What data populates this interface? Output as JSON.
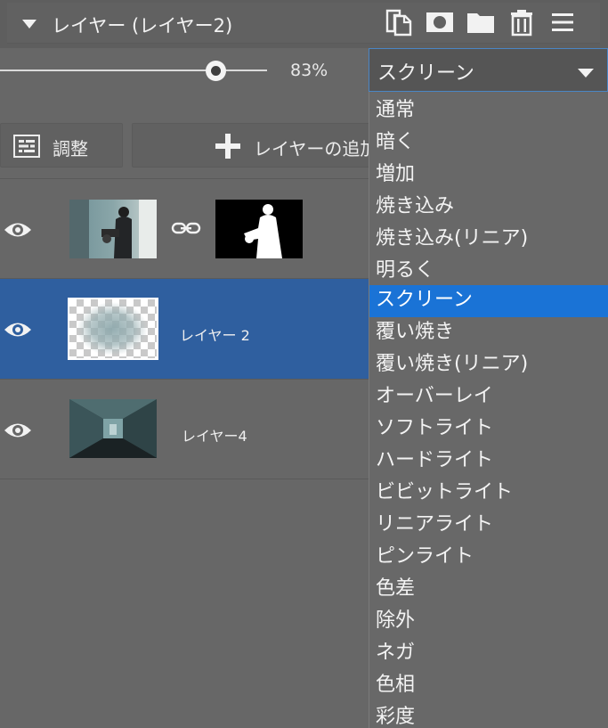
{
  "panel": {
    "title": "レイヤー (レイヤー2)",
    "icons": [
      "duplicate-layer-icon",
      "add-mask-icon",
      "folder-icon",
      "delete-icon",
      "menu-icon"
    ]
  },
  "opacity": {
    "value": 83,
    "label": "83%"
  },
  "blend_mode": {
    "selected": "スクリーン",
    "options": [
      "通常",
      "暗く",
      "増加",
      "焼き込み",
      "焼き込み(リニア)",
      "明るく",
      "スクリーン",
      "覆い焼き",
      "覆い焼き(リニア)",
      "オーバーレイ",
      "ソフトライト",
      "ハードライト",
      "ビビットライト",
      "リニアライト",
      "ピンライト",
      "色差",
      "除外",
      "ネガ",
      "色相",
      "彩度"
    ]
  },
  "buttons": {
    "adjust": "調整",
    "add_layer": "レイヤーの追加"
  },
  "layers": [
    {
      "name": "",
      "visible": true,
      "linked_mask": true,
      "selected": false
    },
    {
      "name": "レイヤー 2",
      "visible": true,
      "linked_mask": false,
      "selected": true
    },
    {
      "name": "レイヤー4",
      "visible": true,
      "linked_mask": false,
      "selected": false
    }
  ],
  "colors": {
    "selection": "#2f5f9f",
    "accent": "#1a73d6",
    "panel": "#676767"
  }
}
